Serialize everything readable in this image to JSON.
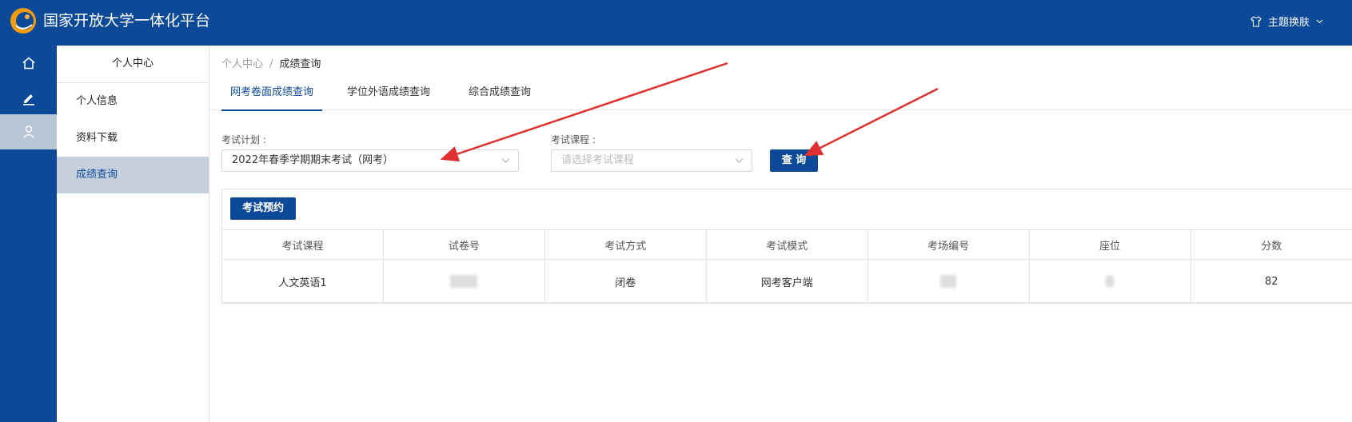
{
  "app": {
    "title": "国家开放大学一体化平台",
    "theme_label": "主题换肤"
  },
  "sidebar_icons": [
    "home-icon",
    "edit-icon",
    "user-icon"
  ],
  "subnav": {
    "title": "个人中心",
    "items": [
      {
        "label": "个人信息"
      },
      {
        "label": "资料下载"
      },
      {
        "label": "成绩查询"
      }
    ]
  },
  "breadcrumb": {
    "root": "个人中心",
    "separator": "/",
    "current": "成绩查询"
  },
  "tabs": [
    {
      "label": "网考卷面成绩查询"
    },
    {
      "label": "学位外语成绩查询"
    },
    {
      "label": "综合成绩查询"
    }
  ],
  "filters": {
    "plan_label": "考试计划 :",
    "plan_value": "2022年春季学期期末考试（网考）",
    "course_label": "考试课程 :",
    "course_placeholder": "请选择考试课程"
  },
  "buttons": {
    "query": "查 询",
    "reserve": "考试预约"
  },
  "table": {
    "headers": [
      "考试课程",
      "试卷号",
      "考试方式",
      "考试模式",
      "考场编号",
      "座位",
      "分数"
    ],
    "rows": [
      {
        "course": "人文英语1",
        "paper_no": "",
        "method": "闭卷",
        "mode": "网考客户端",
        "room_no": "",
        "seat": "",
        "score": "82"
      }
    ]
  },
  "colors": {
    "brand": "#0c4a99",
    "annotation_arrow": "#e03030"
  }
}
